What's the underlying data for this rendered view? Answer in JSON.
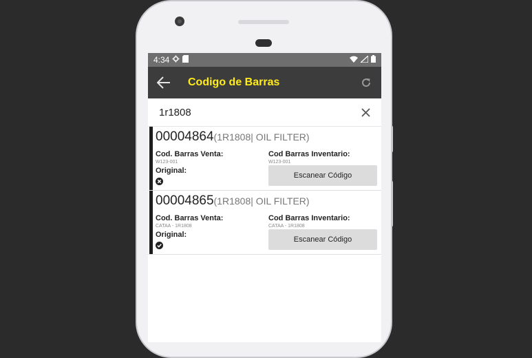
{
  "status_bar": {
    "time": "4:34"
  },
  "app_bar": {
    "title": "Codigo de Barras"
  },
  "search": {
    "value": "1r1808"
  },
  "items": [
    {
      "code": "00004864",
      "meta": "(1R1808| OIL FILTER)",
      "venta_label": "Cod. Barras Venta:",
      "venta_value": "W123-001",
      "inventario_label": "Cod Barras Inventario:",
      "inventario_value": "W123-001",
      "original_label": "Original:",
      "original_state": "x-circle-icon",
      "button_label": "Escanear Código"
    },
    {
      "code": "00004865",
      "meta": "(1R1808| OIL FILTER)",
      "venta_label": "Cod. Barras Venta:",
      "venta_value": "CATAA - 1R1808",
      "inventario_label": "Cod Barras Inventario:",
      "inventario_value": "CATAA - 1R1808",
      "original_label": "Original:",
      "original_state": "check-circle-icon",
      "button_label": "Escanear Código"
    }
  ],
  "colors": {
    "title": "#ffec1a",
    "app_bar": "#3c3c3c",
    "status_bar": "#6e6e6e",
    "button": "#dcdcdc"
  }
}
